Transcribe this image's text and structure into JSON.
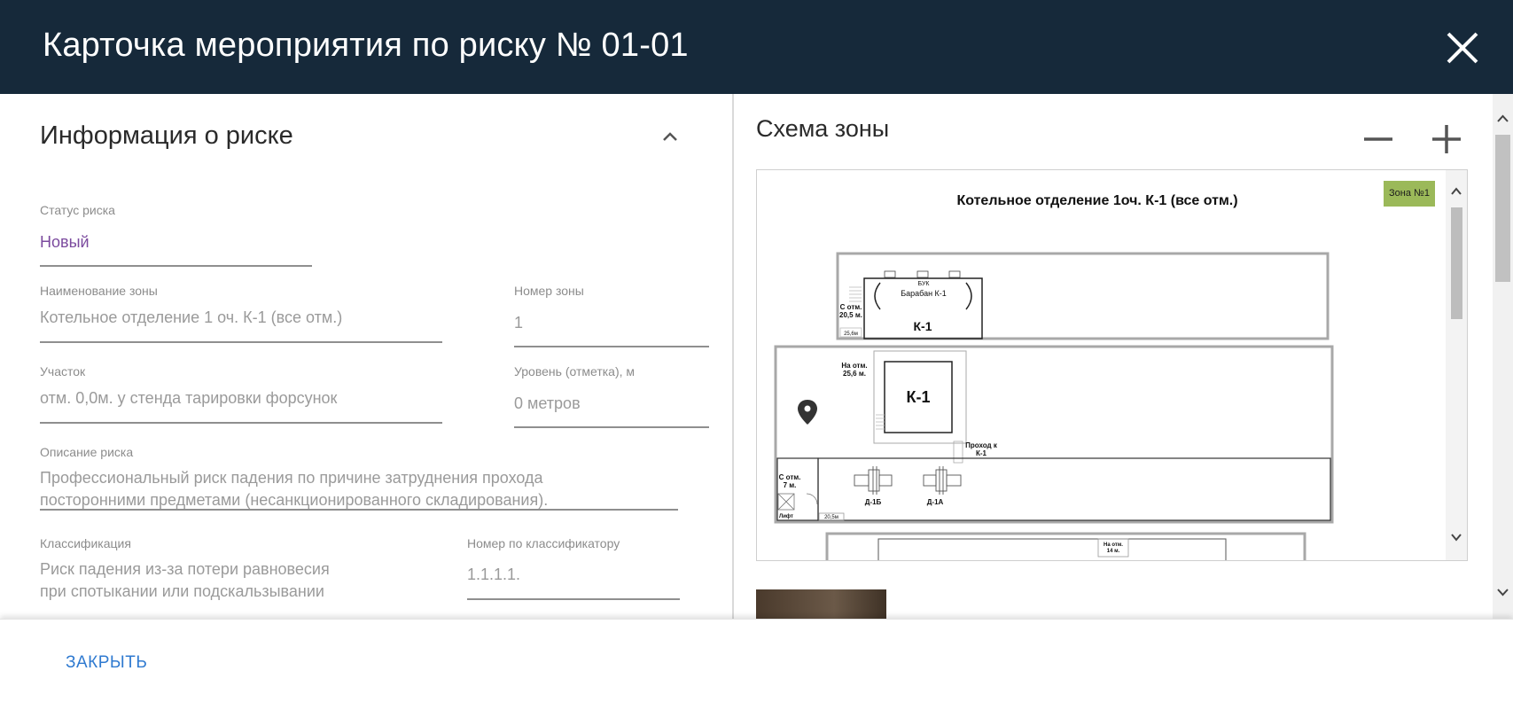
{
  "header": {
    "title": "Карточка мероприятия по риску № 01-01"
  },
  "info": {
    "section_title": "Информация о риске",
    "status": {
      "label": "Статус риска",
      "value": "Новый"
    },
    "zone_name": {
      "label": "Наименование зоны",
      "value": "Котельное отделение 1 оч. К-1 (все отм.)"
    },
    "zone_number": {
      "label": "Номер зоны",
      "value": "1"
    },
    "site": {
      "label": "Участок",
      "value": "отм. 0,0м. у стенда тарировки форсунок"
    },
    "level": {
      "label": "Уровень (отметка), м",
      "value": "0 метров"
    },
    "description": {
      "label": "Описание риска",
      "line1": "Профессиональный риск падения по причине затруднения прохода",
      "line2": "посторонними предметами (несанкционированного складирования)."
    },
    "classification": {
      "label": "Классификация",
      "line1": "Риск падения из-за потери равновесия",
      "line2": "при спотыкании или подскальзывании"
    },
    "classifier_number": {
      "label": "Номер по классификатору",
      "value": "1.1.1.1."
    }
  },
  "scheme": {
    "title": "Схема зоны",
    "zone_badge": "Зона №1",
    "map_title": "Котельное отделение 1оч. К-1 (все отм.)",
    "plan_labels": {
      "buk": "БУК",
      "drum": "Барабан К-1",
      "k1_top": "К-1",
      "c_otm_line1": "С отм.",
      "c_otm_line2": "20,5 м.",
      "mark_256": "25,6м",
      "na_otm_line1": "На отм.",
      "na_otm_line2": "25,6 м.",
      "k1_mid": "К-1",
      "passage_line1": "Проход к",
      "passage_line2": "К-1",
      "c7_line1": "С отм.",
      "c7_line2": "7 м.",
      "lift": "Лифт",
      "mark_205": "20,5м",
      "d1b": "Д-1Б",
      "d1a": "Д-1А",
      "na14_line1": "На отм.",
      "na14_line2": "14 м."
    }
  },
  "footer": {
    "close_label": "ЗАКРЫТЬ"
  },
  "colors": {
    "header_bg": "#16293a",
    "status_value": "#7b4a9e",
    "zone_badge": "#9bb959",
    "link": "#2f7ad0"
  },
  "icons": {
    "close": "close-icon",
    "collapse": "chevron-up-icon",
    "zoom_out": "minus-icon",
    "zoom_in": "plus-icon",
    "marker": "map-marker-icon"
  }
}
